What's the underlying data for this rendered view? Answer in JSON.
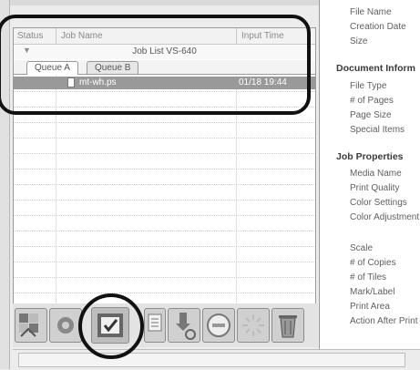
{
  "job_list": {
    "columns": [
      "Status",
      "Job Name",
      "Input Time"
    ],
    "title": "Job List VS-640",
    "collapse_arrow": "▼",
    "tabs": [
      "Queue A",
      "Queue B"
    ],
    "active_tab": "Queue A",
    "jobs": [
      {
        "name": "mt-wh.ps",
        "time": "01/18 19:44"
      }
    ]
  },
  "properties": {
    "file_info": [
      "File Name",
      "Creation Date",
      "Size"
    ],
    "document_header": "Document Inform",
    "document_info": [
      "File Type",
      "# of Pages",
      "Page Size",
      "Special Items"
    ],
    "job_header": "Job Properties",
    "job_info": [
      "Media Name",
      "Print Quality",
      "Color Settings",
      "Color Adjustment"
    ],
    "job_info_2": [
      "Scale",
      "# of Copies",
      "# of Tiles",
      "Mark/Label",
      "Print Area",
      "Action After Print"
    ]
  },
  "toolbar": {
    "buttons": [
      {
        "name": "layout-icon"
      },
      {
        "name": "gear-icon"
      },
      {
        "name": "print-check-icon",
        "highlighted": true
      },
      {
        "name": "document-list-icon"
      },
      {
        "name": "export-icon"
      },
      {
        "name": "stop-icon"
      },
      {
        "name": "pause-icon"
      },
      {
        "name": "trash-icon"
      }
    ]
  },
  "colors": {
    "selected_row": "#999999",
    "callout": "#111111",
    "panel_border": "#9a9a9a"
  }
}
